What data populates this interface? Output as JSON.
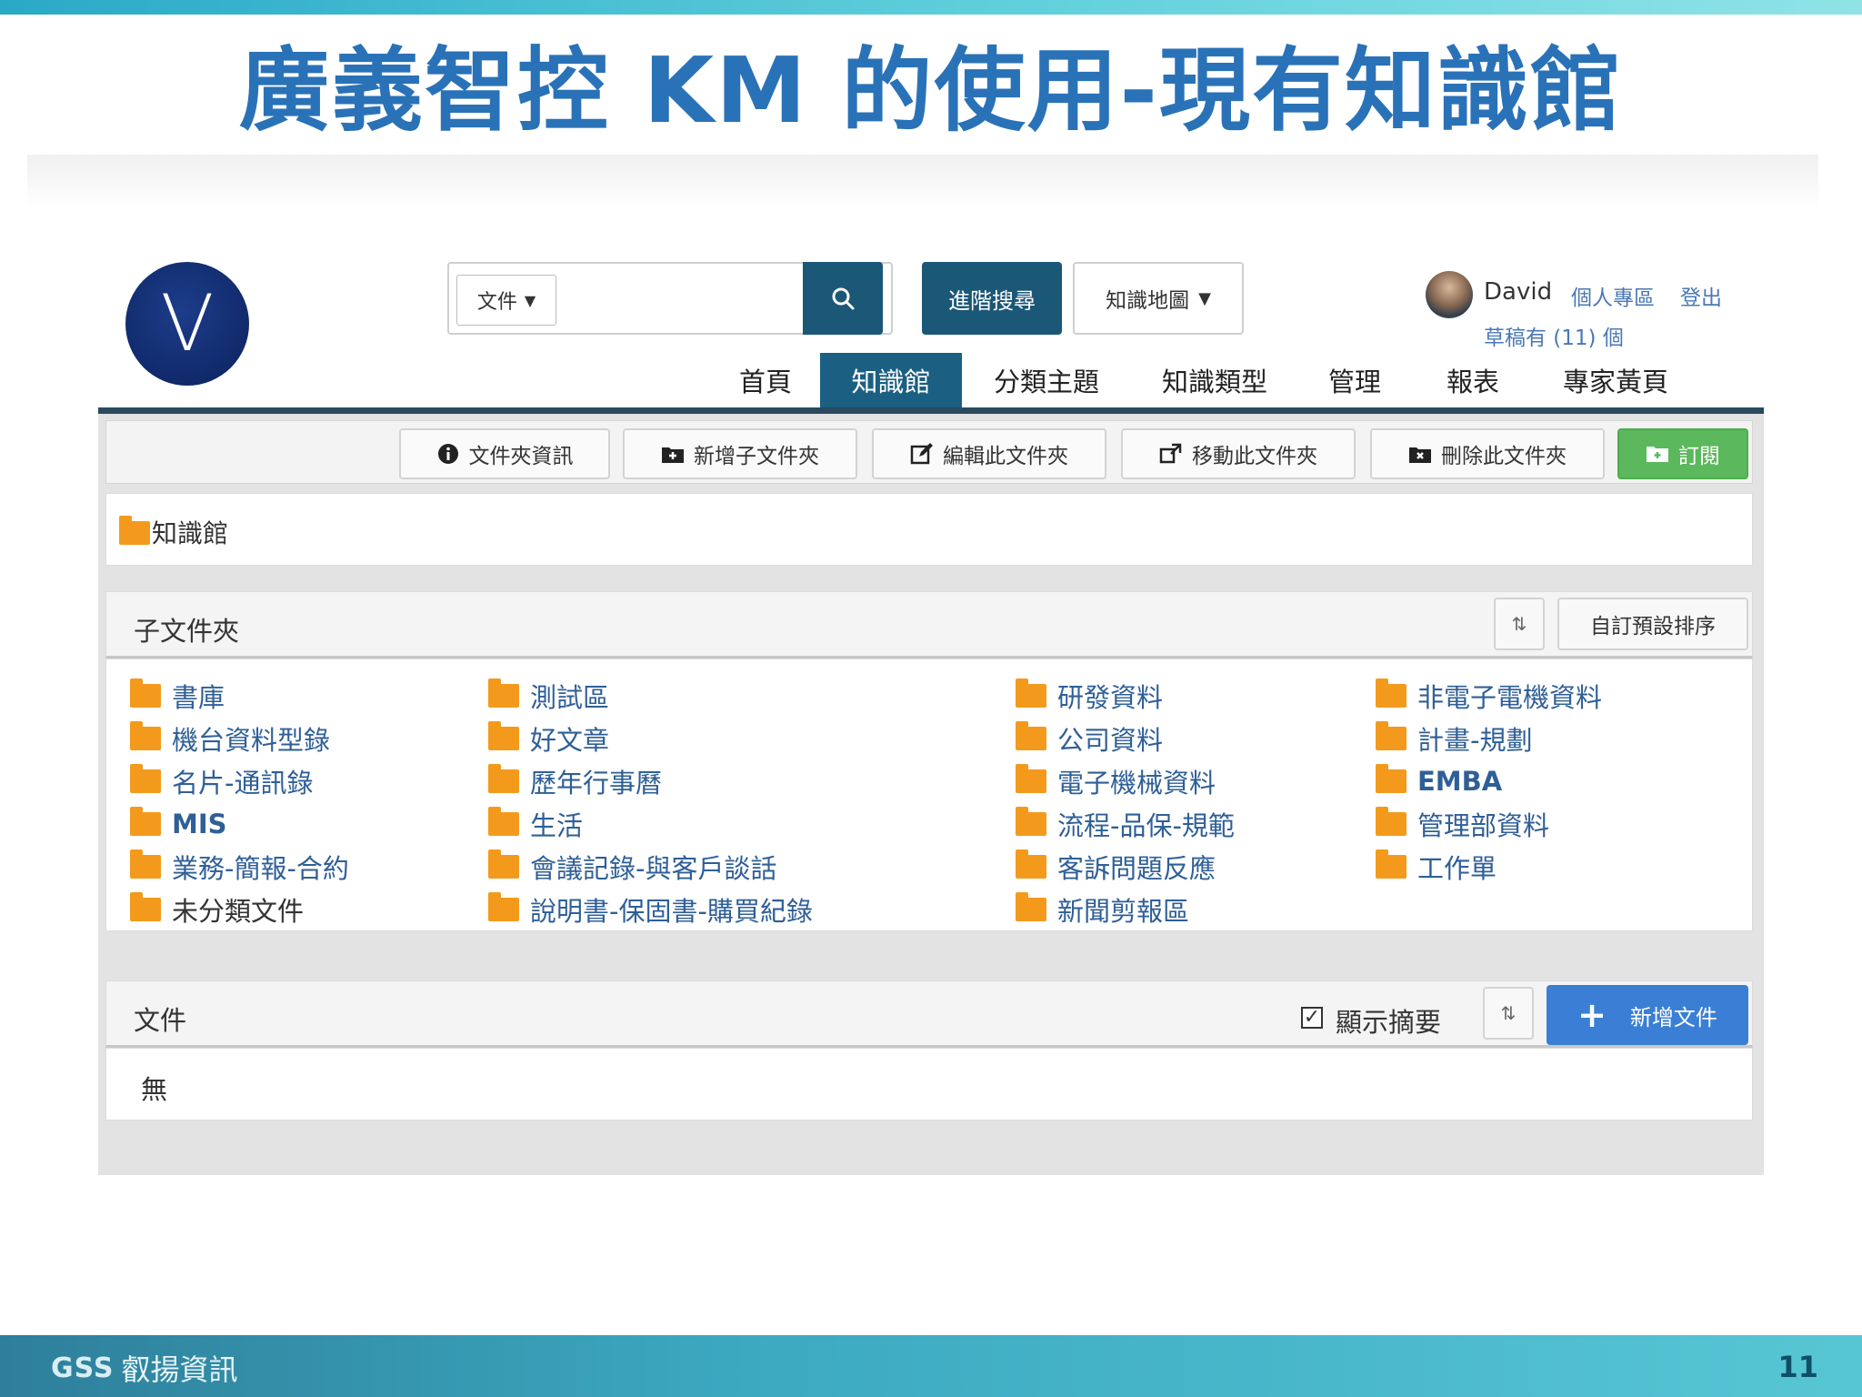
{
  "slide": {
    "title": "廣義智控 KM 的使用-現有知識館",
    "footer_logo_mark": "GSS",
    "footer_company": "叡揚資訊",
    "page_number": "11"
  },
  "app": {
    "logo_letter": "V",
    "search": {
      "type_selected": "文件",
      "query": "",
      "advanced_label": "進階搜尋",
      "map_label": "知識地圖"
    },
    "user": {
      "name": "David",
      "profile_link": "個人專區",
      "logout_link": "登出",
      "draft_text": "草稿有 (11) 個"
    },
    "nav": [
      "首頁",
      "知識館",
      "分類主題",
      "知識類型",
      "管理",
      "報表",
      "專家黃頁"
    ],
    "toolbar": {
      "folder_info": "文件夾資訊",
      "add_subfolder": "新增子文件夾",
      "edit_folder": "編輯此文件夾",
      "move_folder": "移動此文件夾",
      "delete_folder": "刪除此文件夾",
      "subscribe": "訂閱"
    },
    "breadcrumb": "知識館",
    "subfolders": {
      "title": "子文件夾",
      "default_sort_label": "自訂預設排序",
      "columns": [
        [
          "書庫",
          "機台資料型錄",
          "名片-通訊錄",
          "MIS",
          "業務-簡報-合約",
          "未分類文件"
        ],
        [
          "測試區",
          "好文章",
          "歷年行事曆",
          "生活",
          "會議記錄-與客戶談話",
          "說明書-保固書-購買紀錄"
        ],
        [
          "研發資料",
          "公司資料",
          "電子機械資料",
          "流程-品保-規範",
          "客訴問題反應",
          "新聞剪報區"
        ],
        [
          "非電子電機資料",
          "計畫-規劃",
          "EMBA",
          "管理部資料",
          "工作單"
        ]
      ]
    },
    "documents": {
      "title": "文件",
      "show_summary_label": "顯示摘要",
      "show_summary_checked": true,
      "new_doc_label": "新增文件",
      "empty_text": "無"
    }
  },
  "colors": {
    "title_blue": "#2a72b8",
    "nav_active": "#1b5f82",
    "dark_button": "#1b5777",
    "subscribe_green": "#5cb85c",
    "new_doc_blue": "#3a7fd5",
    "folder_orange": "#f39a1d",
    "link_blue": "#2f5f97"
  }
}
